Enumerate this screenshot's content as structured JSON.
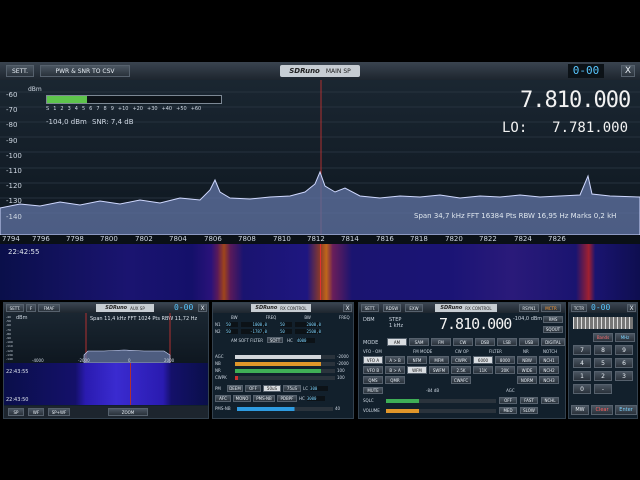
{
  "main_window": {
    "buttons": {
      "sett": "SETT.",
      "pwr_csv": "PWR & SNR TO CSV"
    },
    "logo": "SDRuno",
    "title": "MAIN SP",
    "clock": "0-00",
    "close": "X",
    "dbm_label": "dBm",
    "s_scale": [
      "S",
      "1",
      "2",
      "3",
      "4",
      "5",
      "6",
      "7",
      "8",
      "9",
      "+10",
      "+20",
      "+30",
      "+40",
      "+50",
      "+60"
    ],
    "level": "-104,0 dBm",
    "snr": "SNR: 7,4 dB",
    "freq_main": "7.810.000",
    "lo_label": "LO:",
    "freq_lo": "7.781.000",
    "y_ticks": [
      "-60",
      "-70",
      "-80",
      "-90",
      "-100",
      "-110",
      "-120",
      "-130",
      "-140"
    ],
    "x_ticks": [
      "7796",
      "7798",
      "7800",
      "7802",
      "7804",
      "7806",
      "7808",
      "7810",
      "7812",
      "7814",
      "7816",
      "7818",
      "7820",
      "7822",
      "7824",
      "7826",
      "7794"
    ],
    "footer": "Span 34,7 kHz  FFT 16384 Pts  RBW 16,95 Hz  Marks 0,2 kH",
    "wf_time_1": "22:42:55"
  },
  "aux_window": {
    "buttons": [
      "SETT.",
      "F",
      "FMAF"
    ],
    "logo": "SDRuno",
    "title": "AUX SP",
    "clock": "0-00",
    "close": "X",
    "dbm": "dBm",
    "footer": "Span 11,4 kHz  FFT 1024 Pts  RBW 11,72 Hz",
    "y_ticks": [
      "-40",
      "-50",
      "-60",
      "-70",
      "-80",
      "-90",
      "-100",
      "-110",
      "-120",
      "-130",
      "-140"
    ],
    "x_ticks": [
      "-4000",
      "-2000",
      "0",
      "2000"
    ],
    "times": [
      "22:43:55",
      "22:43:50"
    ],
    "bottom": [
      "SP",
      "WF",
      "SP+WF",
      "ZOOM"
    ]
  },
  "rx_window": {
    "logo": "SDRuno",
    "title": "RX CONTROL",
    "clock": "0-00",
    "close": "X",
    "cols": [
      "BW",
      "FREQ",
      "BW",
      "FREQ"
    ],
    "rows": [
      {
        "label": "N1",
        "a": "50",
        "b": "1000,0",
        "c": "50",
        "d": "2000,0"
      },
      {
        "label": "N2",
        "a": "50",
        "b": "-1787,0",
        "c": "50",
        "d": "2500,0"
      }
    ],
    "am_filter": "AM SOFT FILTER",
    "soft": "SOFT",
    "hc": "HC",
    "hc_val": "4000",
    "sliders": [
      {
        "label": "AGC",
        "value": "-2000",
        "fill": 0.86
      },
      {
        "label": "NB",
        "value": "-2000",
        "fill": 0.86
      },
      {
        "label": "NR",
        "value": "100",
        "fill": 0.86
      },
      {
        "label": "CWPK",
        "value": "100",
        "fill": 0.0
      }
    ],
    "fm_buttons": [
      "DEEM",
      "OFF",
      "50uS",
      "75uS",
      "LC",
      "300"
    ],
    "afc_buttons": [
      "AFC",
      "MONO",
      "PMS-NB",
      "PDBPF",
      "HC",
      "3000"
    ],
    "pms": "PMS-NB",
    "pms_val": "40",
    "pm": "PM"
  },
  "rx_control": {
    "sett": "SETT.",
    "rdsw": "RDSW",
    "exw": "EXW",
    "logo": "SDRuno",
    "title": "RX CONTROL",
    "rsyn": "RSYN1",
    "mctr": "MCTR",
    "tctr": "TCTR",
    "clock": "0-00",
    "close": "X",
    "dbm_label": "DBM",
    "step": "STEP",
    "step_val": "1 kHz",
    "freq": "7.810.000",
    "dbm_val": "-104,0 dBm",
    "rms": "RMS",
    "sqout": "SQOUT",
    "mode_label": "MODE",
    "modes": [
      "AM",
      "SAM",
      "FM",
      "CW",
      "DSB",
      "LSB",
      "USB",
      "DIGITAL"
    ],
    "vfo_label": "VFO - OM",
    "fm_mode_label": "FM MODE",
    "cw_op_label": "CW OP",
    "filter_label": "FILTER",
    "nr_label": "NR",
    "notch_label": "NOTCH",
    "vfo_btns": [
      "VFO A",
      "A > B",
      "NFM",
      "MFM",
      "CWPK",
      "6000",
      "8000",
      "NBW",
      "NCH1"
    ],
    "vfo_btns2": [
      "VFO B",
      "B > A",
      "WFM",
      "SWFM",
      "2.5K",
      "11K",
      "20K",
      "WIDE",
      "NCH2"
    ],
    "qms_btns": [
      "QMS",
      "QMR",
      "CWAFC",
      "NORM",
      "NCH3"
    ],
    "mute": "MUTE",
    "mute_val": "-84 dB",
    "sqlc": "SQLC",
    "sqlc_btns": [
      "OFF",
      "FAST",
      "NCHL"
    ],
    "volume": "VOLUME",
    "vol_btns": [
      "MED",
      "SLOW"
    ],
    "agc_label": "AGC",
    "keypad": [
      "7",
      "8",
      "9",
      "4",
      "5",
      "6",
      "1",
      "2",
      "3",
      "0",
      "-"
    ],
    "keypad_top": [
      "Bands",
      "MHz"
    ],
    "keypad_bottom": [
      "MW",
      "Clear",
      "Enter"
    ]
  }
}
